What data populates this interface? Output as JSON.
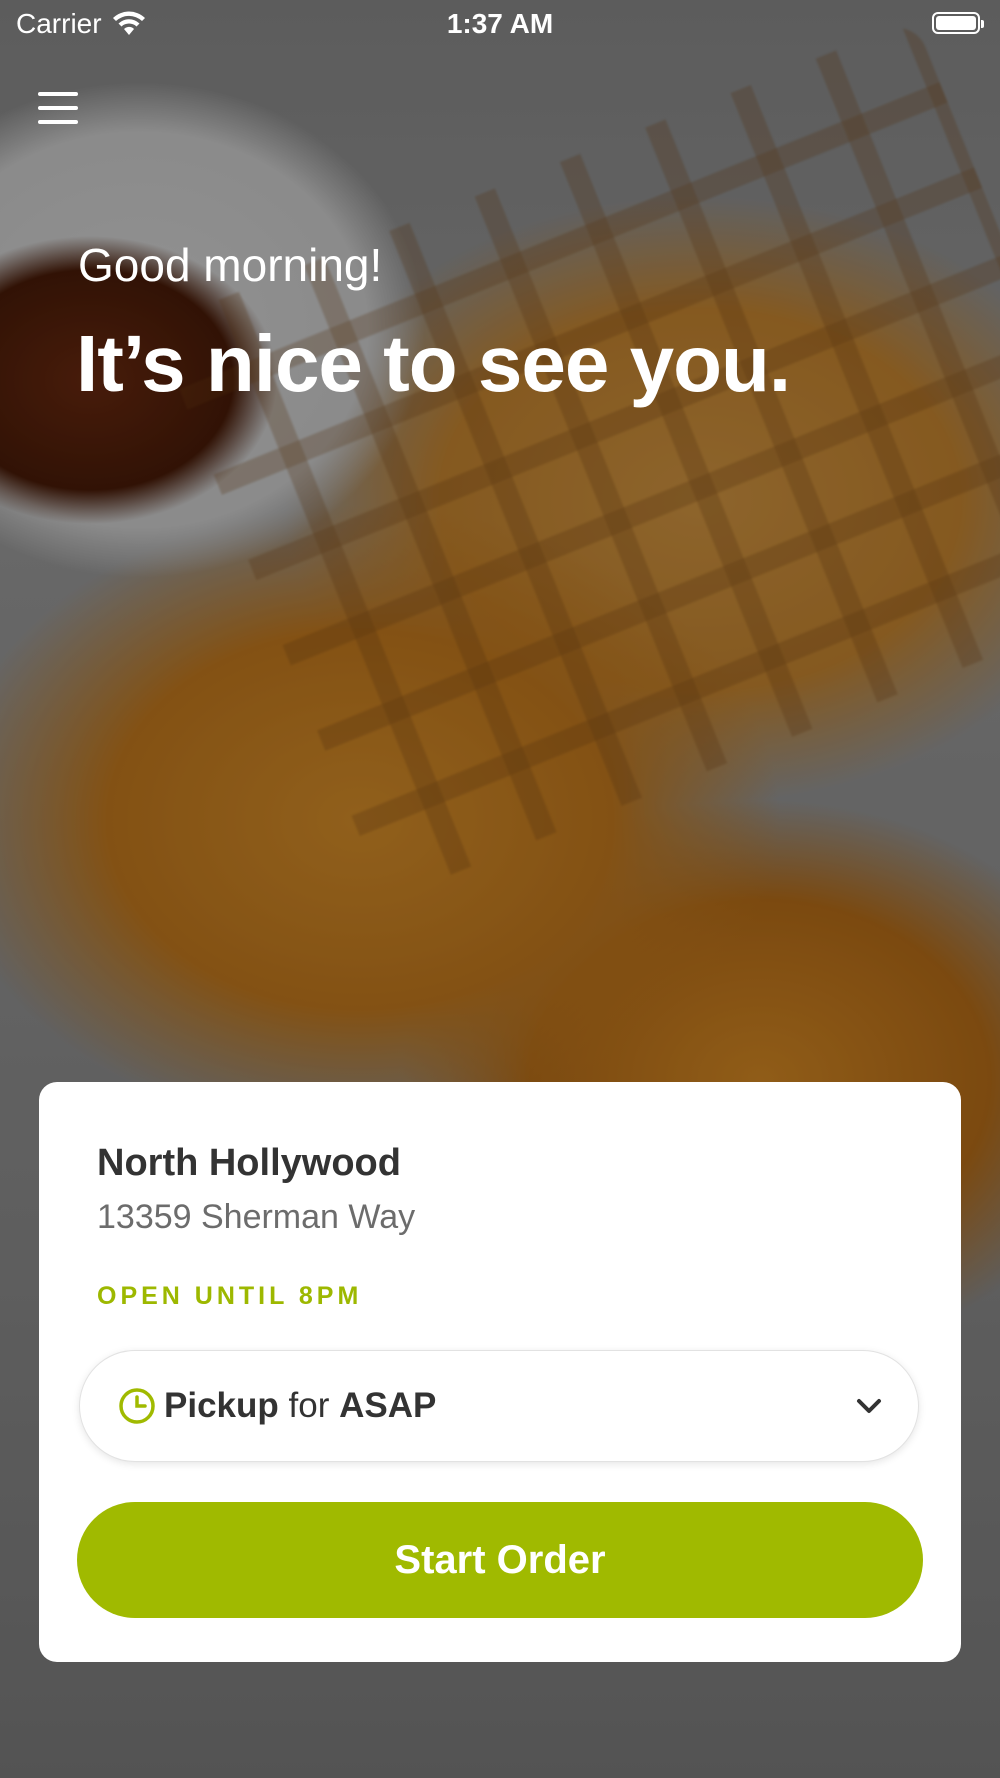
{
  "status_bar": {
    "carrier": "Carrier",
    "time": "1:37 AM"
  },
  "hero": {
    "greeting": "Good morning!",
    "headline": "It’s nice to see you."
  },
  "location_card": {
    "name": "North Hollywood",
    "address": "13359 Sherman Way",
    "hours": "OPEN UNTIL 8PM",
    "order_mode": {
      "mode": "Pickup",
      "connector": "for",
      "time": "ASAP"
    },
    "start_button": "Start Order"
  },
  "colors": {
    "accent": "#a0ba00",
    "hours_text": "#9db800"
  },
  "icons": [
    "wifi-icon",
    "battery-icon",
    "menu-icon",
    "clock-icon",
    "chevron-down-icon"
  ]
}
